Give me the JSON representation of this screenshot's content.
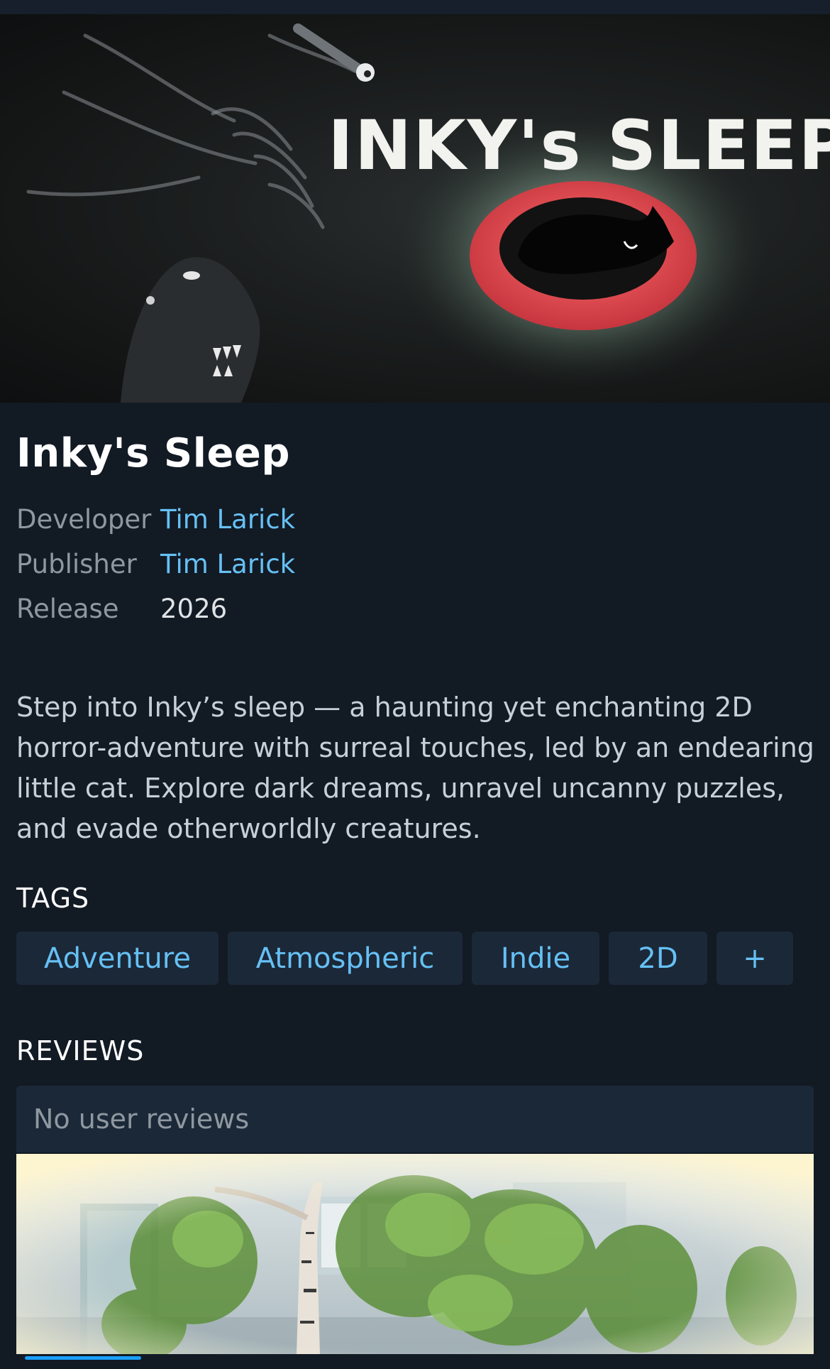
{
  "game": {
    "title": "Inky's Sleep",
    "hero_logo_text": "INKY's SLEEP",
    "hero_alt": "Inky's Sleep key art",
    "developer_label": "Developer",
    "developer": "Tim Larick",
    "publisher_label": "Publisher",
    "publisher": "Tim Larick",
    "release_label": "Release",
    "release": "2026",
    "description": "Step into Inky’s sleep — a haunting yet enchanting 2D horror-adventure with surreal touches, led by an endearing little cat. Explore dark dreams, unravel uncanny puzzles, and evade otherworldly creatures."
  },
  "tags": {
    "heading": "TAGS",
    "items": [
      "Adventure",
      "Atmospheric",
      "Indie",
      "2D"
    ],
    "more_label": "+"
  },
  "reviews": {
    "heading": "REVIEWS",
    "empty_text": "No user reviews"
  },
  "colors": {
    "background": "#121a24",
    "panel": "#1b2838",
    "link": "#66c0f4",
    "muted": "#8f98a0",
    "accent": "#1a9fff"
  }
}
